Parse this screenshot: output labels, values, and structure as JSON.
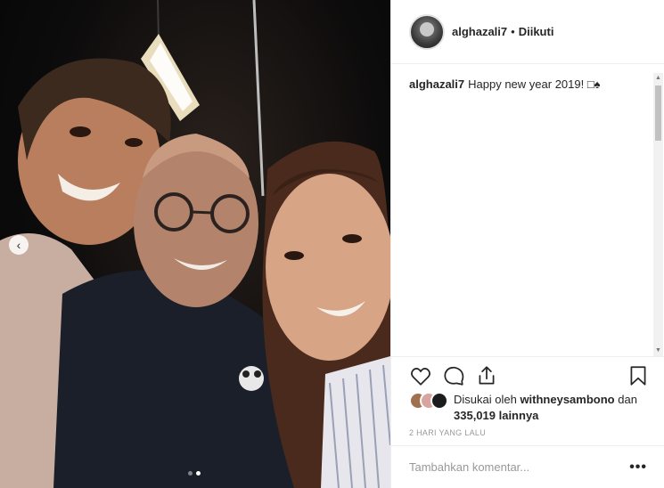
{
  "post": {
    "username": "alghazali7",
    "separator": "•",
    "follow_status": "Diikuti",
    "caption_user": "alghazali7",
    "caption_text": "Happy new year 2019! □♠",
    "likes_prefix": "Disukai oleh ",
    "likes_user": "withneysambono",
    "likes_connector": " dan ",
    "likes_count": "335,019 lainnya",
    "timestamp": "2 HARI YANG LALU",
    "comment_placeholder": "Tambahkan komentar...",
    "more_label": "•••"
  },
  "carousel": {
    "prev_label": "‹",
    "slide_count": 2,
    "active_slide": 2
  },
  "icons": {
    "like": "heart-icon",
    "comment": "comment-icon",
    "share": "share-icon",
    "save": "bookmark-icon"
  },
  "colors": {
    "border": "#efefef",
    "text": "#262626",
    "muted": "#999999"
  }
}
